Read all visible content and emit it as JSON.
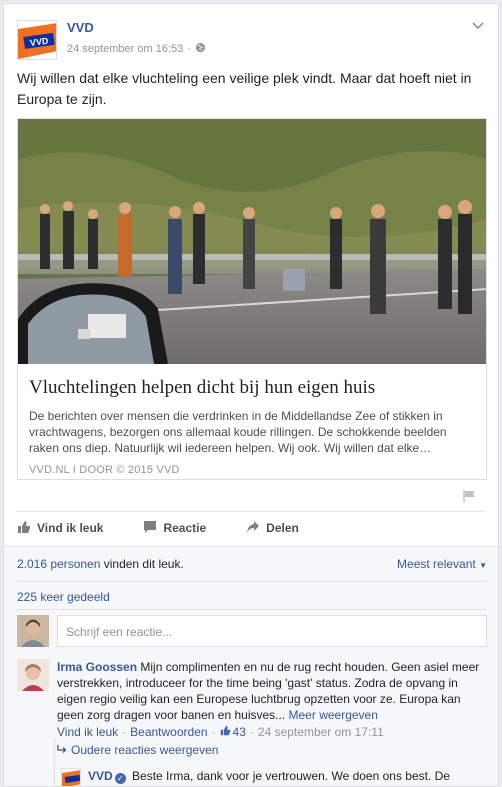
{
  "post": {
    "page_name": "VVD",
    "logo_text_top": "VRIJHEID",
    "logo_text_mid": "VVD",
    "date": "24 september om 16:53",
    "separator": "·",
    "text": "Wij willen dat elke vluchteling een veilige plek vindt. Maar dat hoeft niet in Europa te zijn."
  },
  "link": {
    "title": "Vluchtelingen helpen dicht bij hun eigen huis",
    "description": "De berichten over mensen die verdrinken in de Middellandse Zee of stikken in vrachtwagens, bezorgen ons allemaal koude rillingen. De schokkende beelden raken ons diep. Natuurlijk wil iedereen helpen. Wij ook. Wij willen dat elke…",
    "source": "VVD.NL  I  DOOR © 2015 VVD"
  },
  "actions": {
    "like": "Vind ik leuk",
    "comment": "Reactie",
    "share": "Delen"
  },
  "ufi": {
    "likes_count": "2.016 personen",
    "likes_suffix": " vinden dit leuk.",
    "sort": "Meest relevant",
    "shares": "225 keer gedeeld",
    "write_placeholder": "Schrijf een reactie..."
  },
  "comment": {
    "author": "Irma Goossen",
    "text": "Mijn complimenten en nu de rug recht houden. Geen asiel meer verstrekken, introduceer for the time being 'gast' status. Zodra de opvang in eigen regio veilig kan een Europese luchtbrug opzetten voor ze. Europa kan geen zorg dragen voor banen en huisves...",
    "more": "Meer weergeven",
    "like": "Vind ik leuk",
    "reply": "Beantwoorden",
    "like_count": "43",
    "time": "24 september om 17:11",
    "dot": "·"
  },
  "replies": {
    "label": "Oudere reacties weergeven"
  },
  "reply": {
    "author": "VVD",
    "text": "Beste Irma, dank voor je vertrouwen. We doen ons best. De opvang in de regio is van het grootste belang. In Nederland draagt"
  },
  "colors": {
    "link": "#365899",
    "vvd_orange": "#f37021",
    "vvd_blue": "#0b2fa0"
  }
}
